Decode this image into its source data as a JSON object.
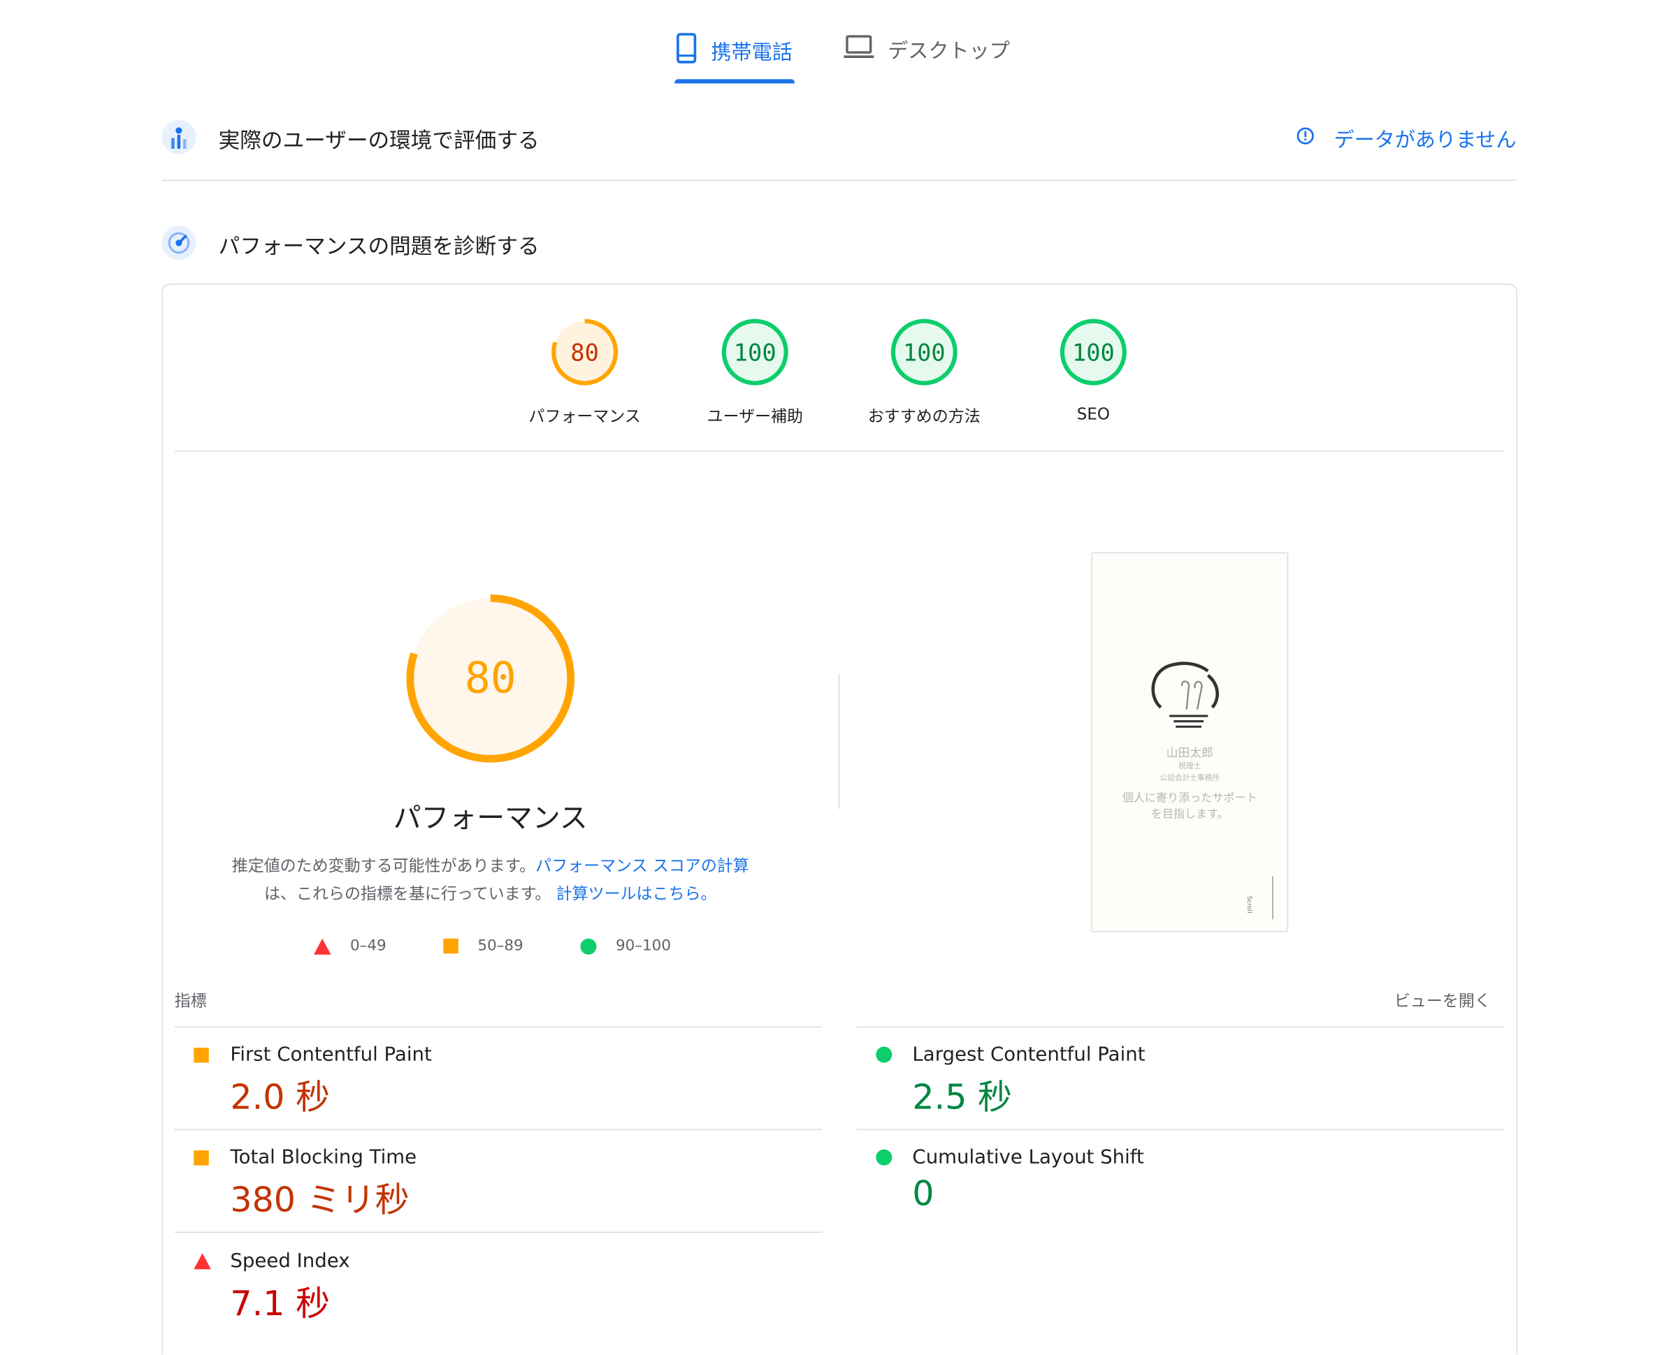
{
  "tabs": {
    "mobile": "携帯電話",
    "desktop": "デスクトップ"
  },
  "field_data": {
    "title": "実際のユーザーの環境で評価する",
    "no_data": "データがありません"
  },
  "diagnose": {
    "title": "パフォーマンスの問題を診断する"
  },
  "gauges": [
    {
      "score": "80",
      "label": "パフォーマンス",
      "status": "average",
      "fraction": 0.8
    },
    {
      "score": "100",
      "label": "ユーザー補助",
      "status": "pass",
      "fraction": 1.0
    },
    {
      "score": "100",
      "label": "おすすめの方法",
      "status": "pass",
      "fraction": 1.0
    },
    {
      "score": "100",
      "label": "SEO",
      "status": "pass",
      "fraction": 1.0
    }
  ],
  "main_gauge": {
    "score": "80",
    "title": "パフォーマンス",
    "fraction": 0.8
  },
  "description": {
    "text1": "推定値のため変動する可能性があります。",
    "link1": "パフォーマンス スコアの計算",
    "text2": "は、これらの指標を基に行っています。",
    "link2": "計算ツールはこちら。"
  },
  "legend": {
    "fail": "0–49",
    "average": "50–89",
    "pass": "90–100"
  },
  "metrics_header": {
    "label": "指標",
    "expand": "ビューを開く"
  },
  "metrics": [
    {
      "name": "First Contentful Paint",
      "value": "2.0 秒",
      "status": "average"
    },
    {
      "name": "Largest Contentful Paint",
      "value": "2.5 秒",
      "status": "pass"
    },
    {
      "name": "Total Blocking Time",
      "value": "380 ミリ秒",
      "status": "average"
    },
    {
      "name": "Cumulative Layout Shift",
      "value": "0",
      "status": "pass"
    },
    {
      "name": "Speed Index",
      "value": "7.1 秒",
      "status": "fail"
    }
  ],
  "page_screenshot": {
    "name": "山田太郎",
    "role": "税理士",
    "office": "公認会計士事務所",
    "tagline1": "個人に寄り添ったサポート",
    "tagline2": "を目指します。",
    "scroll": "Scroll"
  },
  "colors": {
    "accent": "#1a73e8",
    "average": "#ffa400",
    "pass": "#0cce6b",
    "fail": "#ff3333"
  }
}
